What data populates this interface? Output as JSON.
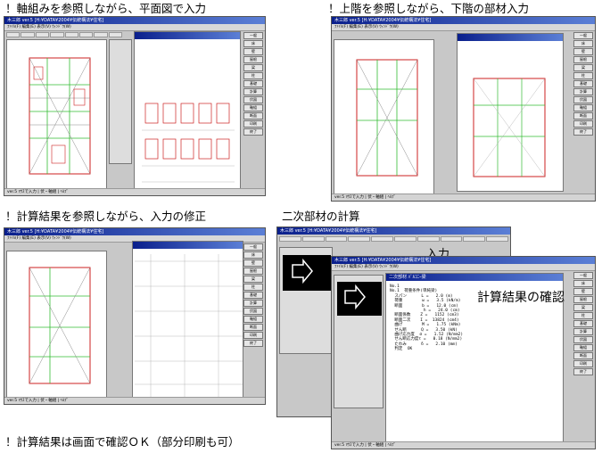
{
  "captions": {
    "c1": "！軸組みを参照しながら、平面図で入力",
    "c2": "！上階を参照しながら、下階の部材入力",
    "c3": "！計算結果を参照しながら、入力の修正",
    "c4": "二次部材の計算",
    "c5": "！計算結果は画面で確認ＯＫ（部分印刷も可）"
  },
  "overlays": {
    "input_label": "入力",
    "result_check": "計算結果の確認"
  },
  "window": {
    "title": "木三郎 ver.5 [H:¥DATA¥2004¥伝統構法¥住宅]",
    "menu": "ﾌｧｲﾙ(F)  編集(E)  表示(V)  ｳｨﾝﾄﾞｳ(W)",
    "status": "ver.5 ﾏｳｽで入力 | 伏・軸組  | ﾍﾙﾌﾟ"
  },
  "right_buttons": [
    "一般",
    "床",
    "壁",
    "屋根",
    "梁",
    "柱",
    "基礎",
    "計算",
    "伏図",
    "軸組",
    "断面",
    "印刷",
    "終了"
  ],
  "result_doc": {
    "title": "二次部材  ﾊﾞﾙｺﾆｰ梁",
    "lines": [
      "No.1",
      "",
      "No.1  荷重条件(単純梁)",
      "  スパン      L =   2.0 (m)",
      "  荷重        w =   3.5 (kN/m)",
      "  断面        b =   12.0 (cm)",
      "              h =   24.0 (cm)",
      "  断面係数    Z =   1152 (cm3)",
      "  断面二次    I =  13824 (cm4)",
      "",
      "  曲げ        M =   1.75 (kNm)",
      "  せん断      Q =   3.50 (kN)",
      "  曲げ応力度  σ =   1.52 (N/mm2)",
      "  せん断応力度τ =   0.18 (N/mm2)",
      "  たわみ      δ =   2.10 (mm)",
      "",
      "  判定  OK"
    ]
  }
}
